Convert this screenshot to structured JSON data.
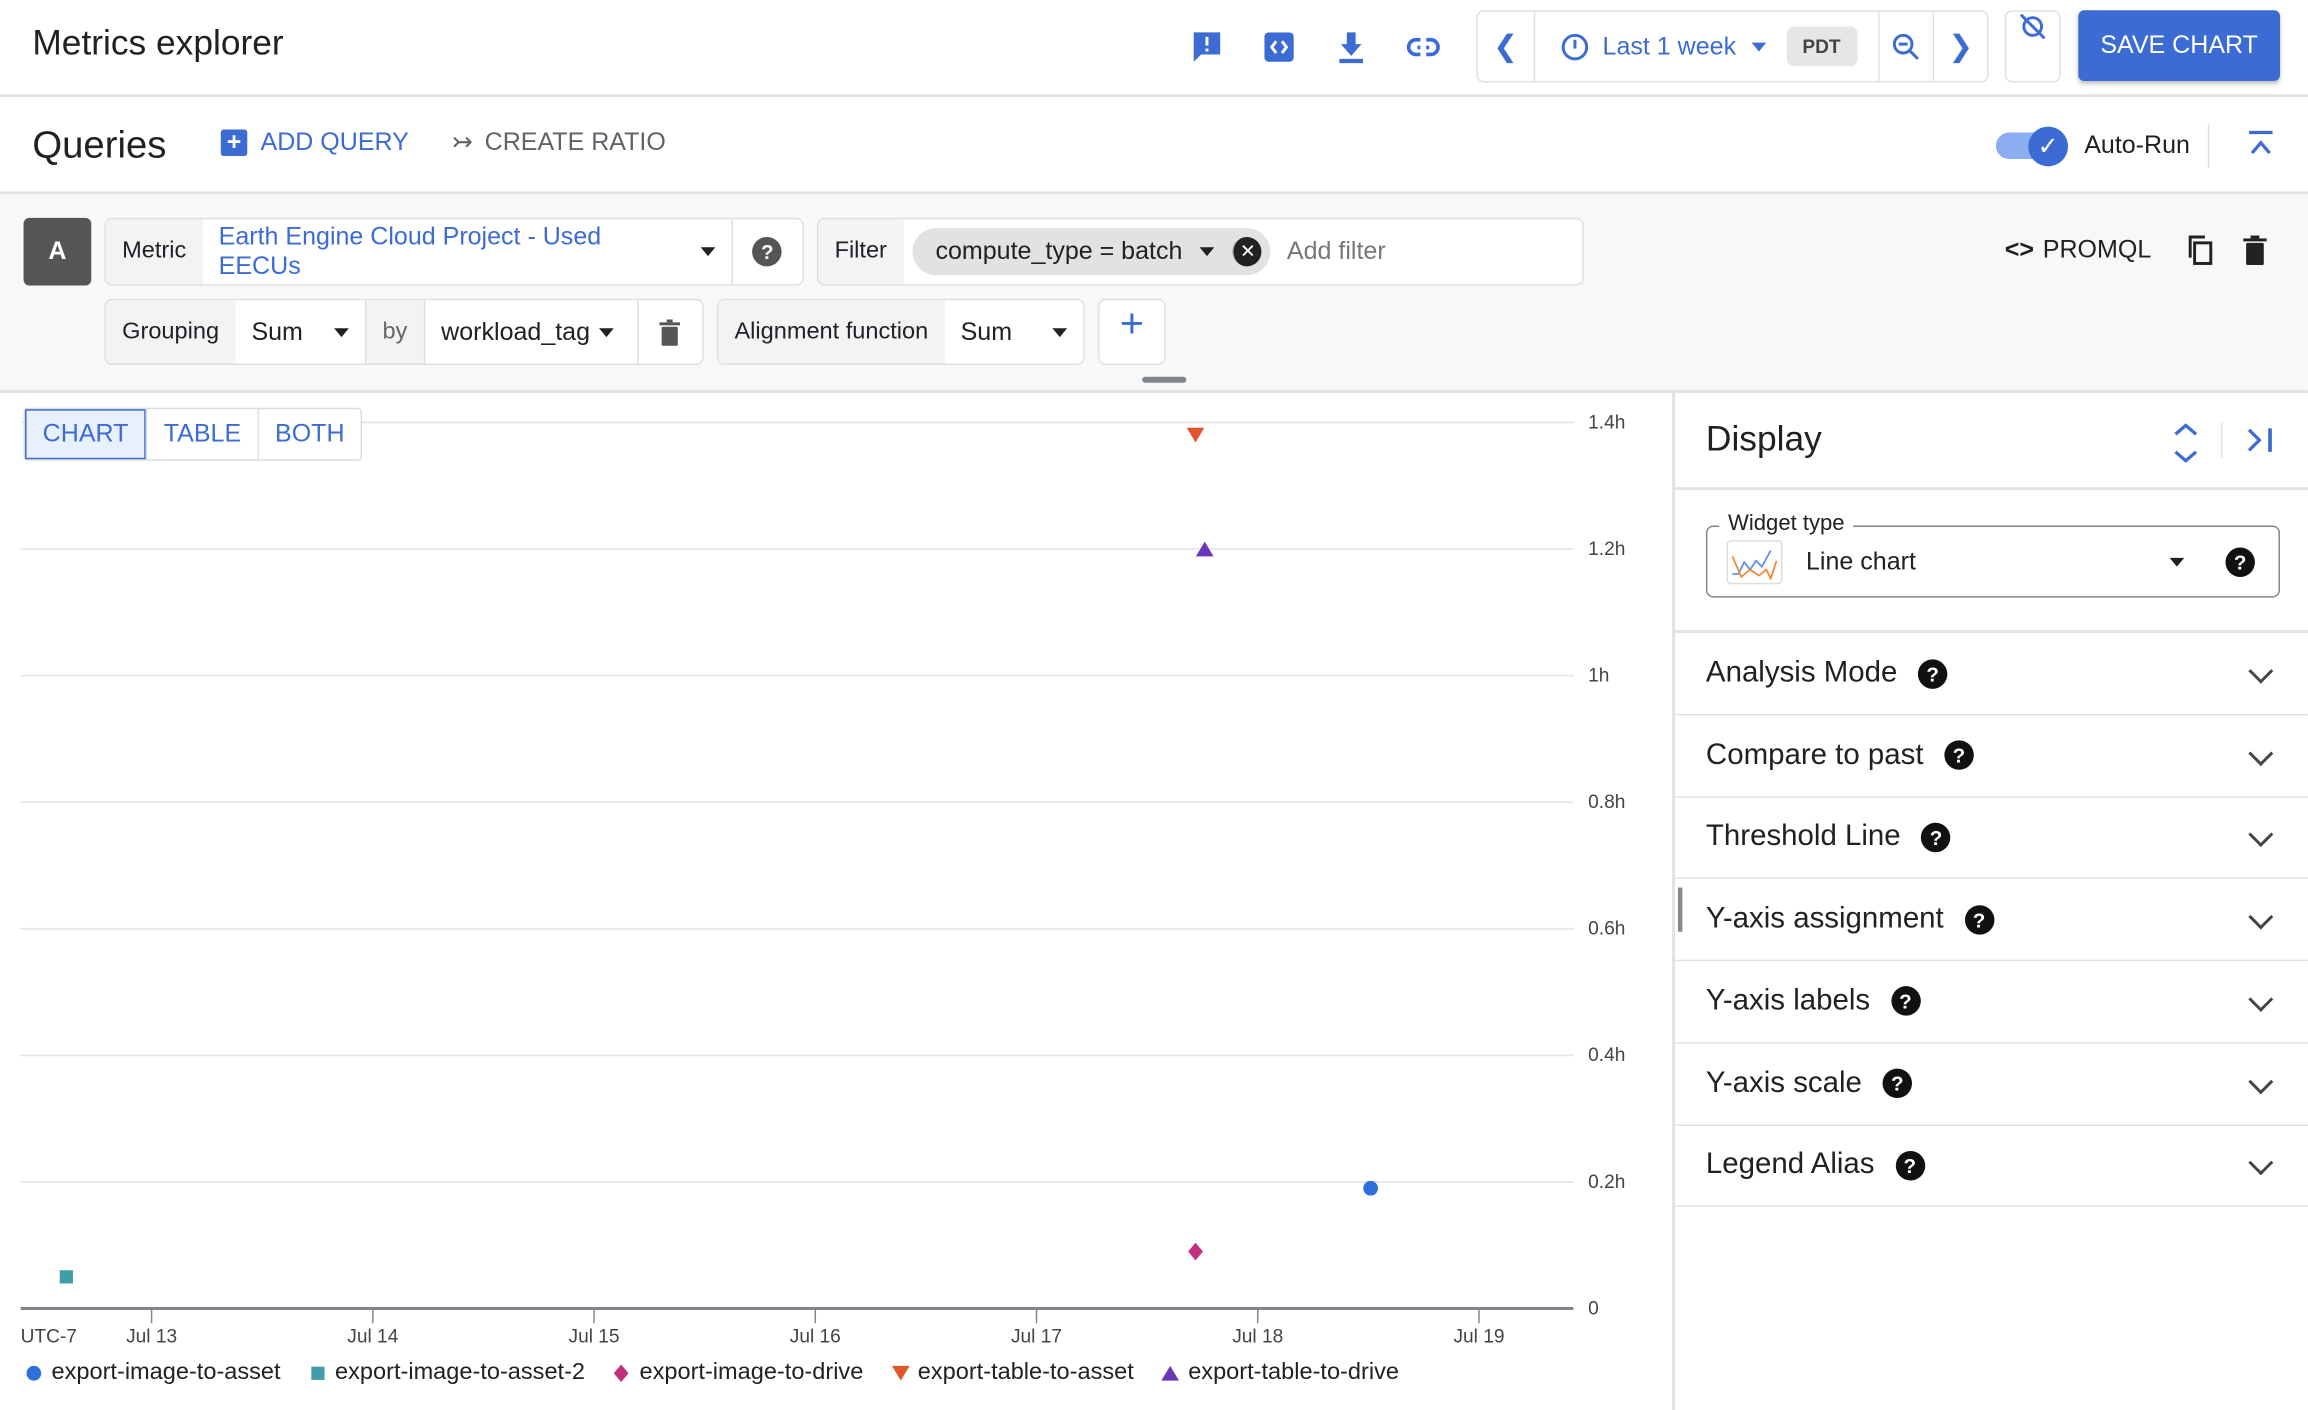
{
  "header": {
    "title": "Metrics explorer",
    "time_range": "Last 1 week",
    "timezone": "PDT",
    "save_label": "SAVE CHART",
    "icons": [
      "feedback-icon",
      "code-icon",
      "download-icon",
      "link-icon",
      "chevron-left-icon",
      "clock-icon",
      "zoom-out-icon",
      "chevron-right-icon",
      "auto-refresh-off-icon"
    ]
  },
  "queries": {
    "title": "Queries",
    "add_query": "ADD QUERY",
    "create_ratio": "CREATE RATIO",
    "auto_run": "Auto-Run",
    "auto_run_on": true
  },
  "query_a": {
    "letter": "A",
    "metric_label": "Metric",
    "metric_value": "Earth Engine Cloud Project - Used EECUs",
    "filter_label": "Filter",
    "filter_chip": "compute_type = batch",
    "filter_placeholder": "Add filter",
    "grouping_label": "Grouping",
    "grouping_value": "Sum",
    "by_label": "by",
    "by_value": "workload_tag",
    "alignment_label": "Alignment function",
    "alignment_value": "Sum",
    "promql": "PROMQL"
  },
  "view_tabs": [
    {
      "label": "CHART",
      "active": true
    },
    {
      "label": "TABLE"
    },
    {
      "label": "BOTH"
    }
  ],
  "display": {
    "title": "Display",
    "widget_type_label": "Widget type",
    "widget_type_value": "Line chart",
    "sections": [
      "Analysis Mode",
      "Compare to past",
      "Threshold Line",
      "Y-axis assignment",
      "Y-axis labels",
      "Y-axis scale",
      "Legend Alias"
    ]
  },
  "chart_data": {
    "type": "scatter",
    "timezone_label": "UTC-7",
    "x_ticks": [
      "Jul 13",
      "Jul 14",
      "Jul 15",
      "Jul 16",
      "Jul 17",
      "Jul 18",
      "Jul 19"
    ],
    "xlim": [
      "Jul 12 10:00",
      "Jul 19 10:20"
    ],
    "y_ticks": [
      "0",
      "0.2h",
      "0.4h",
      "0.6h",
      "0.8h",
      "1h",
      "1.2h",
      "1.4h"
    ],
    "y_tick_values": [
      0,
      0.2,
      0.4,
      0.6,
      0.8,
      1.0,
      1.2,
      1.4
    ],
    "ylim": [
      0,
      1.4
    ],
    "yunit": "h",
    "grid": true,
    "legend": "bottom",
    "series": [
      {
        "name": "export-image-to-asset",
        "color": "#2f6fdc",
        "marker": "circle",
        "points": [
          {
            "x": "Jul 18 12:15",
            "y": 0.19
          }
        ]
      },
      {
        "name": "export-image-to-asset-2",
        "color": "#3f9ea8",
        "marker": "square",
        "points": [
          {
            "x": "Jul 12 14:45",
            "y": 0.05
          }
        ]
      },
      {
        "name": "export-image-to-drive",
        "color": "#c0307c",
        "marker": "diamond",
        "points": [
          {
            "x": "Jul 17 17:15",
            "y": 0.09
          }
        ]
      },
      {
        "name": "export-table-to-asset",
        "color": "#e0552a",
        "marker": "triangle-down",
        "points": [
          {
            "x": "Jul 17 17:15",
            "y": 1.38
          }
        ]
      },
      {
        "name": "export-table-to-drive",
        "color": "#6a35b8",
        "marker": "triangle-up",
        "points": [
          {
            "x": "Jul 17 18:15",
            "y": 1.2
          }
        ]
      }
    ]
  }
}
